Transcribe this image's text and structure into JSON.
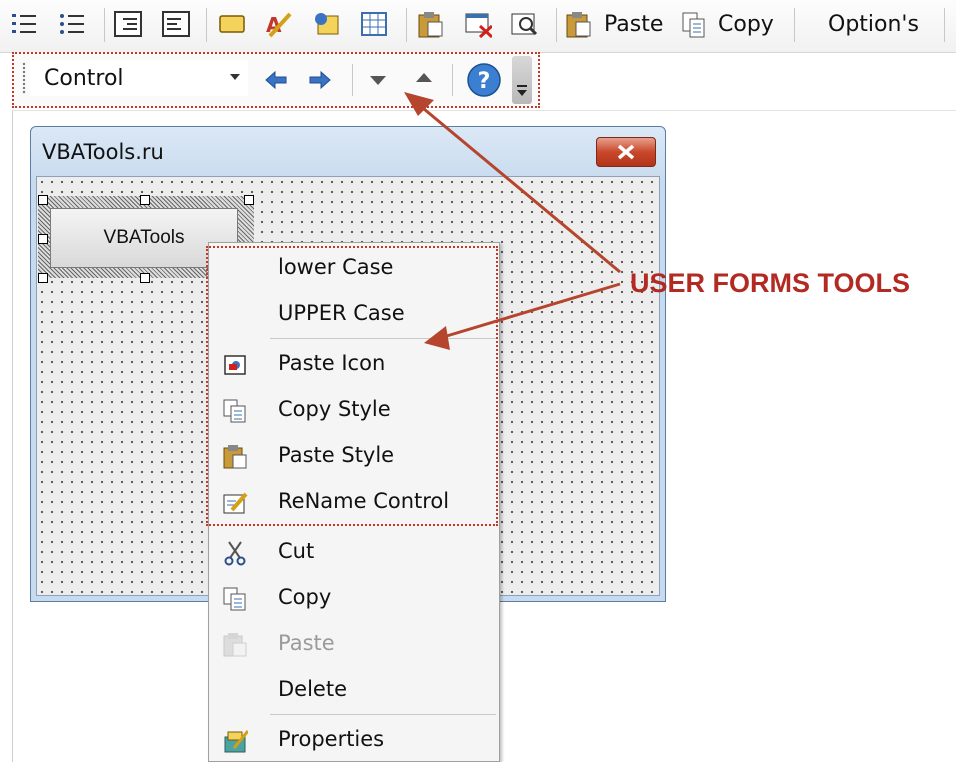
{
  "toolbar1": {
    "paste_label": "Paste",
    "copy_label": "Copy",
    "options_label": "Option's"
  },
  "toolbar2": {
    "combo_value": "Control"
  },
  "form": {
    "title": "VBATools.ru",
    "button_caption": "VBATools"
  },
  "context_menu": {
    "items": [
      {
        "label": "lower Case",
        "icon": "none",
        "enabled": true
      },
      {
        "label": "UPPER Case",
        "icon": "none",
        "enabled": true
      },
      {
        "label": "Paste Icon",
        "icon": "paste-icon-icon",
        "enabled": true
      },
      {
        "label": "Copy Style",
        "icon": "copy-style-icon",
        "enabled": true
      },
      {
        "label": "Paste Style",
        "icon": "paste-style-icon",
        "enabled": true
      },
      {
        "label": "ReName Control",
        "icon": "rename-icon",
        "enabled": true
      },
      {
        "label": "Cut",
        "icon": "scissors-icon",
        "enabled": true
      },
      {
        "label": "Copy",
        "icon": "copy-icon",
        "enabled": true
      },
      {
        "label": "Paste",
        "icon": "paste-icon",
        "enabled": false
      },
      {
        "label": "Delete",
        "icon": "none",
        "enabled": true
      },
      {
        "label": "Properties",
        "icon": "properties-icon",
        "enabled": true
      }
    ]
  },
  "annotation": {
    "text": "USER FORMS TOOLS",
    "color": "#b22a22"
  }
}
